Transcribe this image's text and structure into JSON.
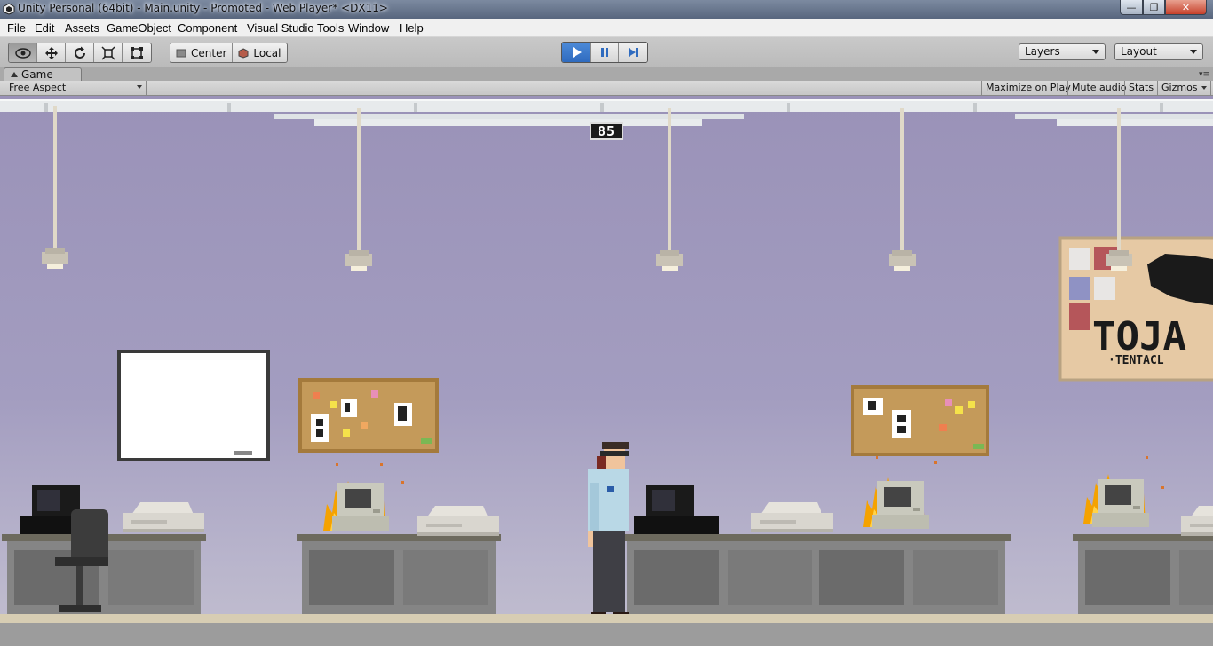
{
  "window": {
    "title": "Unity Personal (64bit) - Main.unity - Promoted - Web Player* <DX11>"
  },
  "menu": [
    "File",
    "Edit",
    "Assets",
    "GameObject",
    "Component",
    "Visual Studio Tools",
    "Window",
    "Help"
  ],
  "toolbar": {
    "tools": [
      "view-tool",
      "move-tool",
      "rotate-tool",
      "scale-tool",
      "rect-tool"
    ],
    "pivot_center": "Center",
    "pivot_local": "Local",
    "playback": [
      "play",
      "pause",
      "step"
    ],
    "layers": "Layers",
    "layout": "Layout"
  },
  "game_tab": {
    "label": "Game",
    "aspect": "Free Aspect",
    "maximize_on_play": "Maximize on Play",
    "mute_audio": "Mute audio",
    "stats": "Stats",
    "gizmos": "Gizmos"
  },
  "game": {
    "score": "85",
    "poster_text": "TOJA",
    "poster_subtext": "·TENTACL"
  },
  "colors": {
    "accent": "#2f6bbf",
    "wall": "#9e95bb",
    "fire": "#f5a200"
  }
}
